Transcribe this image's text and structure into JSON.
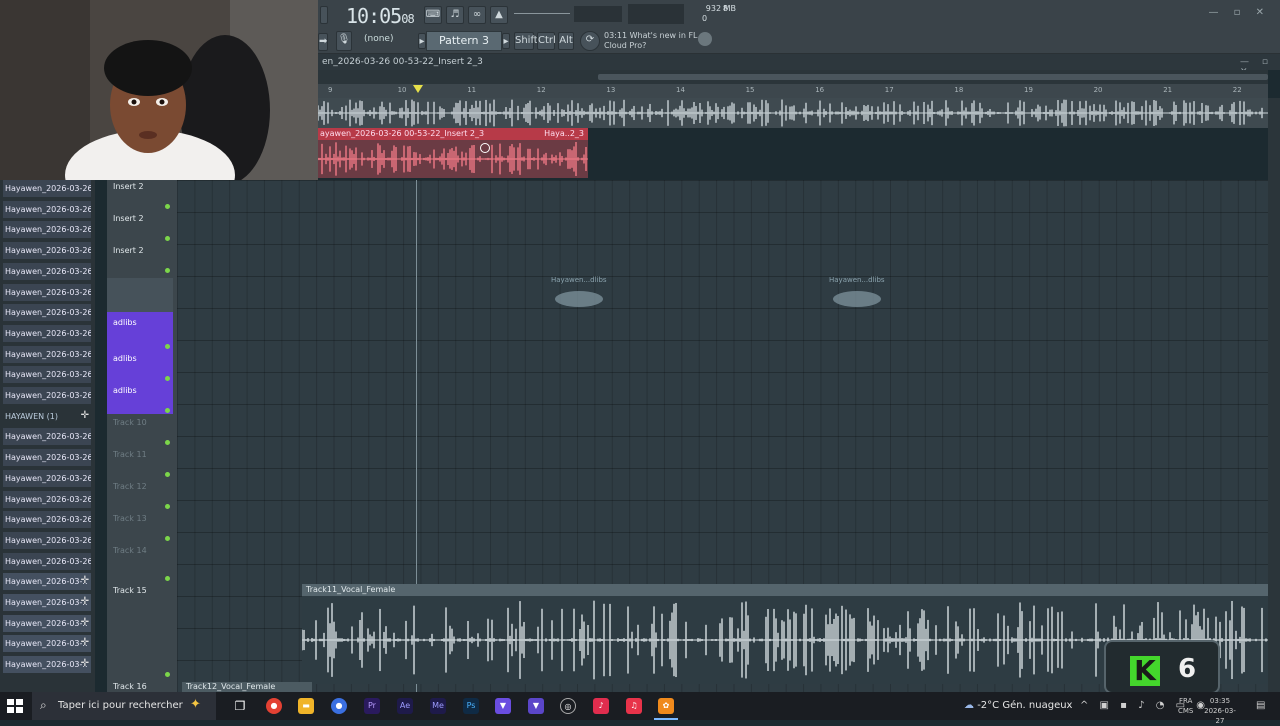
{
  "toolbar": {
    "clock": "10:05",
    "clock_sub": "08",
    "pattern_selector": "(none)",
    "pattern": "Pattern 3",
    "shift_label": "Shift",
    "ctrl_label": "Ctrl",
    "alt_label": "Alt",
    "news_line1": "03:11  What's new in FL",
    "news_line2": "Cloud Pro?",
    "memory_top": "8",
    "memory_mb": "932 MB",
    "memory_bottom": "0"
  },
  "playlist": {
    "title": "en_2026-03-26 00-53-22_Insert 2_3",
    "ruler_ticks": [
      "9",
      "10",
      "11",
      "12",
      "13",
      "14",
      "15",
      "16",
      "17",
      "18",
      "19",
      "20",
      "21",
      "22"
    ]
  },
  "clips": {
    "red_clip_title": "ayawen_2026-03-26 00-53-22_Insert 2_3",
    "red_clip_right": "Haya..2_3",
    "ghost_1": "Hayawen...dlibs",
    "ghost_2": "Hayawen...dlibs",
    "bottom_clip": "Track11_Vocal_Female",
    "bottom_clip_2": "Track12_Vocal_Female"
  },
  "browser": {
    "items": [
      "Hayawen_2026-03-26 02..",
      "Hayawen_2026-03-26 02..",
      "Hayawen_2026-03-26 02..",
      "Hayawen_2026-03-26 02..",
      "Hayawen_2026-03-26 02..",
      "Hayawen_2026-03-26 02..",
      "Hayawen_2026-03-26 02..",
      "Hayawen_2026-03-26 02..",
      "Hayawen_2026-03-26 02..",
      "Hayawen_2026-03-26 02..",
      "Hayawen_2026-03-26 02..",
      "HAYAWEN (1)",
      "Hayawen_2026-03-26 02..",
      "Hayawen_2026-03-26 02..",
      "Hayawen_2026-03-26 02..",
      "Hayawen_2026-03-26 02..",
      "Hayawen_2026-03-26 02..",
      "Hayawen_2026-03-26 02..",
      "Hayawen_2026-03-26 02..",
      "Hayawen_2026-03-..",
      "Hayawen_2026-03-..",
      "Hayawen_2026-03-..",
      "Hayawen_2026-03-..",
      "Hayawen_2026-03-.."
    ]
  },
  "tracks": {
    "insert_1": "Insert 2",
    "insert_2": "Insert 2",
    "insert_3": "Insert 2",
    "adlibs_1": "adlibs",
    "adlibs_2": "adlibs",
    "adlibs_3": "adlibs",
    "track_a": "Track 10",
    "track_b": "Track 11",
    "track_c": "Track 12",
    "track_d": "Track 13",
    "track_e": "Track 14",
    "track_15": "Track 15",
    "track_16": "Track 16"
  },
  "overlay": {
    "k_letter": "K",
    "k_number": "6"
  },
  "taskbar": {
    "search_placeholder": "Taper ici pour rechercher",
    "weather": "-2°C  Gén. nuageux",
    "lang_top": "FRA",
    "lang_bottom": "CMS",
    "time": "03:35",
    "date": "2026-03-27"
  }
}
